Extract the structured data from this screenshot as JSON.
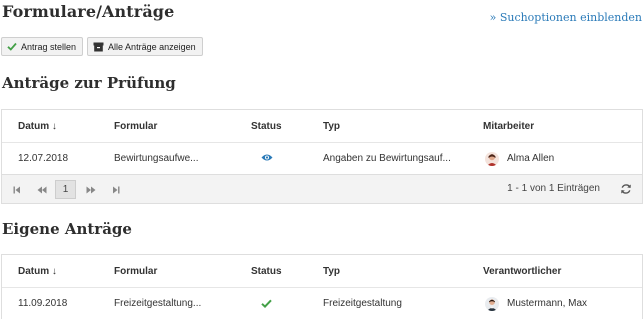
{
  "header": {
    "title": "Formulare/Anträge",
    "search_link": "» Suchoptionen einblenden"
  },
  "toolbar": {
    "new_request": "Antrag stellen",
    "show_all": "Alle Anträge anzeigen"
  },
  "review": {
    "title": "Anträge zur Prüfung",
    "columns": {
      "date": "Datum ↓",
      "form": "Formular",
      "status": "Status",
      "type": "Typ",
      "person": "Mitarbeiter"
    },
    "rows": [
      {
        "date": "12.07.2018",
        "form": "Bewirtungsaufwe...",
        "status_icon": "eye-icon",
        "type": "Angaben zu Bewirtungsauf...",
        "person": "Alma Allen"
      }
    ],
    "pager": {
      "current_page": "1",
      "info": "1 - 1 von 1 Einträgen"
    }
  },
  "own": {
    "title": "Eigene Anträge",
    "columns": {
      "date": "Datum ↓",
      "form": "Formular",
      "status": "Status",
      "type": "Typ",
      "person": "Verantwortlicher"
    },
    "rows": [
      {
        "date": "11.09.2018",
        "form": "Freizeitgestaltung...",
        "status_icon": "check-icon",
        "type": "Freizeitgestaltung",
        "person": "Mustermann, Max"
      }
    ]
  },
  "colors": {
    "link": "#2a7ab8",
    "check": "#43a047",
    "eye": "#2a7ab8"
  }
}
